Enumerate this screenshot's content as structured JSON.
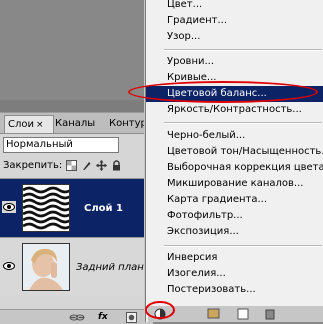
{
  "menu": {
    "items": [
      {
        "label": "Цвет..."
      },
      {
        "label": "Градиент..."
      },
      {
        "label": "Узор..."
      },
      {
        "label": "Уровни..."
      },
      {
        "label": "Кривые..."
      },
      {
        "label": "Цветовой баланс..."
      },
      {
        "label": "Яркость/Контрастность..."
      },
      {
        "label": "Черно-белый..."
      },
      {
        "label": "Цветовой тон/Насыщенность..."
      },
      {
        "label": "Выборочная коррекция цвета..."
      },
      {
        "label": "Микширование каналов..."
      },
      {
        "label": "Карта градиента..."
      },
      {
        "label": "Фотофильтр..."
      },
      {
        "label": "Экспозиция..."
      },
      {
        "label": "Инверсия"
      },
      {
        "label": "Изогелия..."
      },
      {
        "label": "Постеризовать..."
      }
    ],
    "highlighted": "Цветовой баланс...",
    "highlight_color": "#0c2466"
  },
  "layers_panel": {
    "tabs": [
      {
        "label": "Слои",
        "close": "×"
      },
      {
        "label": "Каналы"
      },
      {
        "label": "Контуры"
      }
    ],
    "blend_mode": "Нормальный",
    "lock_label": "Закрепить:",
    "layers": [
      {
        "name": "Слой 1",
        "selected": true,
        "icon": "eye-icon"
      },
      {
        "name": "Задний план",
        "selected": false,
        "icon": "eye-icon"
      }
    ],
    "footer_fx": "fx"
  },
  "annotation_color": "#e00000"
}
